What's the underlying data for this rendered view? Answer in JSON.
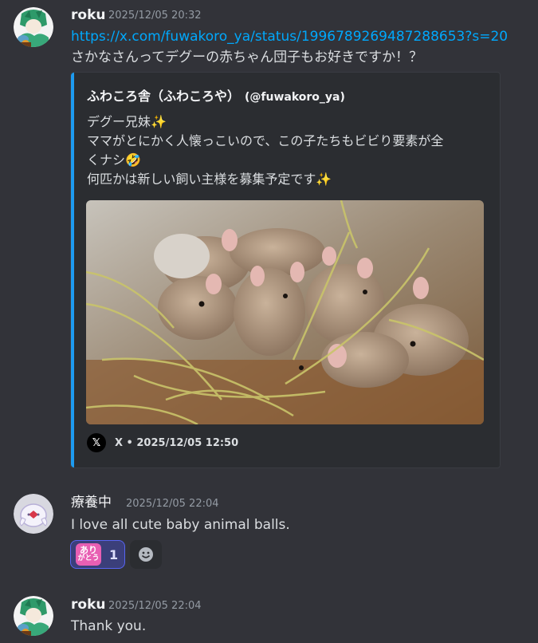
{
  "messages": [
    {
      "username": "roku",
      "timestamp": "2025/12/05 20:32",
      "link": "https://x.com/fuwakoro_ya/status/1996789269487288653?s=20",
      "text": "さかなさんってデグーの赤ちゃん団子もお好きですか！？",
      "embed": {
        "accent_color": "#1d9bf0",
        "author_name": "ふわころ舎（ふわころや）",
        "author_handle": "(@fuwakoro_ya)",
        "description_lines": [
          "デグー兄妹✨",
          "ママがとにかく人懐っこいので、この子たちもビビり要素が全",
          "くナシ🤣",
          "何匹かは新しい飼い主様を募集予定です✨"
        ],
        "image_alt": "baby degus huddled together on hay",
        "footer": "X • 2025/12/05 12:50",
        "footer_icon": "x-logo-icon"
      }
    },
    {
      "username": "療養中",
      "timestamp": "2025/12/05 22:04",
      "text": "I love all cute baby animal balls.",
      "reactions": [
        {
          "emoji_line1": "あり",
          "emoji_line2": "がとう",
          "count": "1",
          "active": true
        },
        {
          "icon": "add-reaction-icon"
        }
      ]
    },
    {
      "username": "roku",
      "timestamp": "2025/12/05 22:04",
      "text": "Thank you."
    }
  ]
}
